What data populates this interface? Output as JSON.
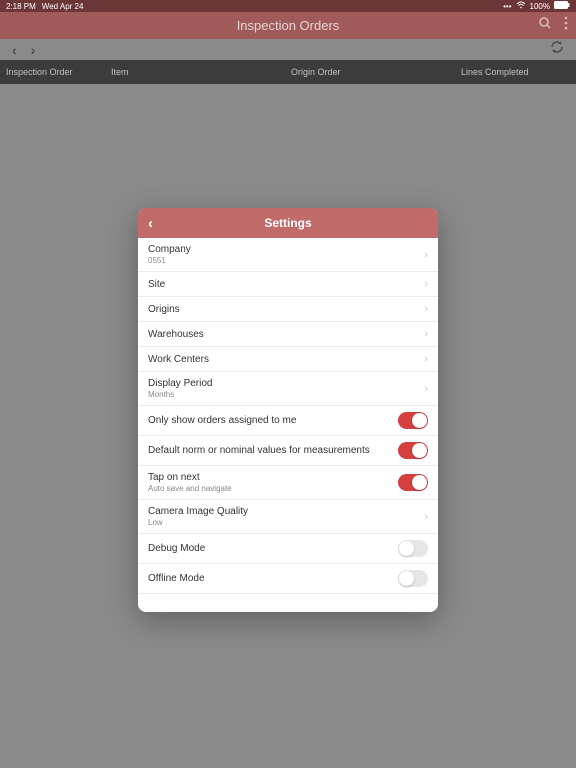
{
  "status": {
    "time": "2:18 PM",
    "date": "Wed Apr 24",
    "battery": "100%"
  },
  "nav": {
    "title": "Inspection Orders"
  },
  "table_header": {
    "col1": "Inspection Order",
    "col2": "Item",
    "col3": "Origin Order",
    "col4": "Lines Completed"
  },
  "modal": {
    "title": "Settings",
    "rows": {
      "company": {
        "label": "Company",
        "value": "0551"
      },
      "site": {
        "label": "Site"
      },
      "origins": {
        "label": "Origins"
      },
      "warehouses": {
        "label": "Warehouses"
      },
      "workcenters": {
        "label": "Work Centers"
      },
      "display_period": {
        "label": "Display Period",
        "value": "Months"
      },
      "assigned": {
        "label": "Only show orders assigned to me",
        "on": true
      },
      "default_norm": {
        "label": "Default norm or nominal values for measurements",
        "on": true
      },
      "tap_next": {
        "label": "Tap on next",
        "value": "Auto save and navigate",
        "on": true
      },
      "camera": {
        "label": "Camera Image Quality",
        "value": "Low"
      },
      "debug": {
        "label": "Debug Mode",
        "on": false
      },
      "offline": {
        "label": "Offline Mode",
        "on": false
      }
    }
  }
}
